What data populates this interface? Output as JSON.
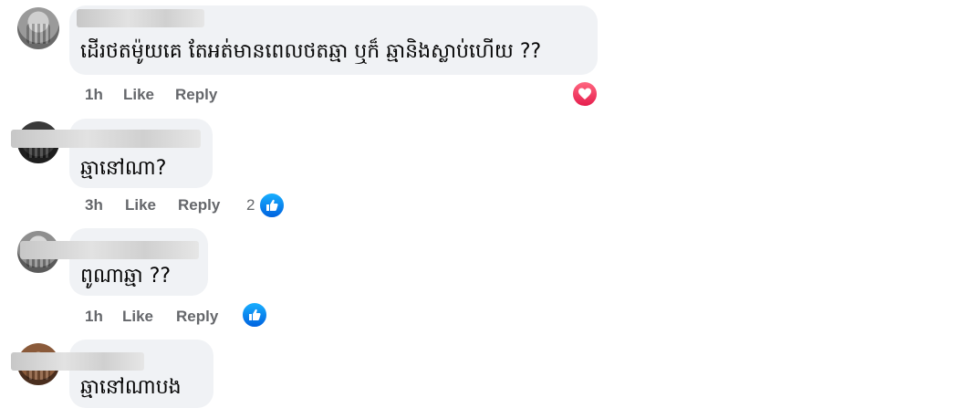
{
  "comments": [
    {
      "text": "ដើរថតម៉ូយគេ តែអត់មានពេលថតឆ្មា ឬក៏ ឆ្មានិងស្លាប់ហើយ ??",
      "time": "1h",
      "like_label": "Like",
      "reply_label": "Reply",
      "reaction": "heart-icon",
      "reaction_count": ""
    },
    {
      "text": "ឆ្មានៅណា?",
      "time": "3h",
      "like_label": "Like",
      "reply_label": "Reply",
      "reaction": "like-thumb-icon",
      "reaction_count": "2"
    },
    {
      "text": "ពូណាឆ្មា ??",
      "time": "1h",
      "like_label": "Like",
      "reply_label": "Reply",
      "reaction": "like-thumb-icon",
      "reaction_count": ""
    },
    {
      "text": "ឆ្មានៅណាបង",
      "time": "",
      "like_label": "",
      "reply_label": "",
      "reaction": "",
      "reaction_count": ""
    }
  ],
  "colors": {
    "bubble": "#f0f2f5",
    "meta_text": "#65676b",
    "like_blue": "#0866ff",
    "love_red": "#f33e58"
  }
}
